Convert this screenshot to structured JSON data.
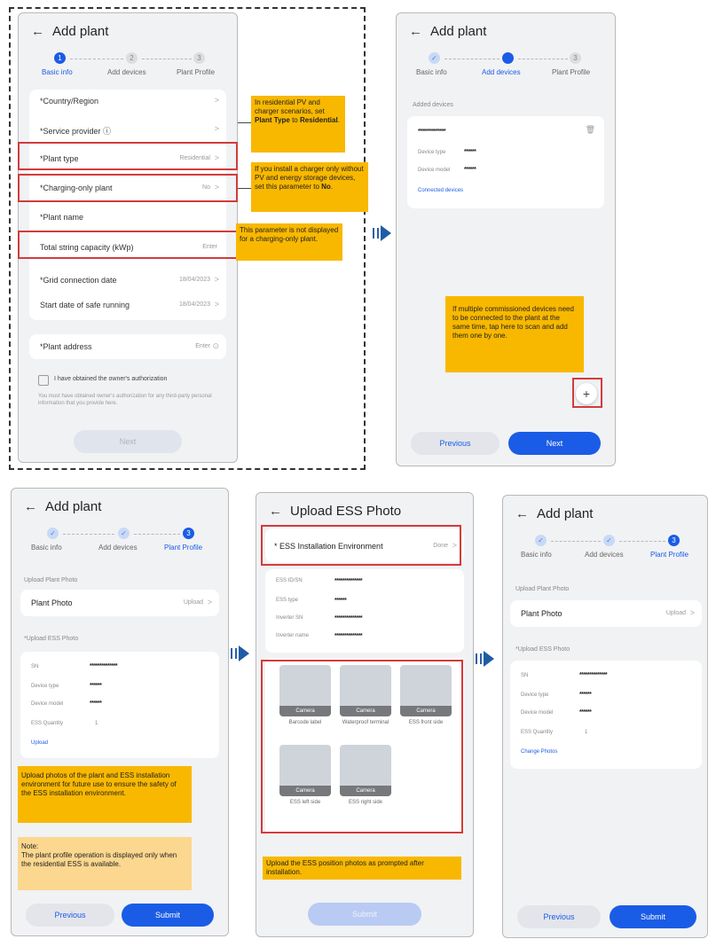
{
  "common": {
    "back_icon": "←",
    "add_plant_title": "Add plant",
    "step_basic": "Basic info",
    "step_devices": "Add devices",
    "step_profile": "Plant Profile",
    "check_glyph": "✓",
    "chevron": ">"
  },
  "screen1": {
    "step_nums": [
      "1",
      "2",
      "3"
    ],
    "rows": [
      {
        "label": "*Country/Region",
        "value": ""
      },
      {
        "label": "*Service provider ⓘ",
        "value": ""
      },
      {
        "label": "*Plant type",
        "value": "Residential"
      },
      {
        "label": "*Charging-only plant",
        "value": "No"
      },
      {
        "label": "*Plant name",
        "value": ""
      },
      {
        "label": "Total string capacity (kWp)",
        "value": "Enter"
      },
      {
        "label": "*Grid connection date",
        "value": "18/04/2023"
      },
      {
        "label": "Start date of safe running",
        "value": "18/04/2023"
      },
      {
        "label": "*Plant address",
        "value": "Enter"
      }
    ],
    "auth_label": "I have obtained the owner's authorization",
    "auth_note": "You must have obtained owner's authorization for any third-party personal information that you provide here.",
    "next_label": "Next",
    "location_icon": "⊙"
  },
  "notes_left": {
    "plant_type_pre": "In residential PV and charger scenarios, set ",
    "plant_type_bold1": "Plant Type",
    "plant_type_mid": " to ",
    "plant_type_bold2": "Residential",
    "plant_type_post": ".",
    "charging_pre": "If you install a charger only without PV and energy storage devices, set this parameter to ",
    "charging_bold": "No",
    "charging_post": ".",
    "capacity": "This parameter is not displayed for a charging-only plant."
  },
  "screen2": {
    "step_num_3": "3",
    "section": "Added devices",
    "masked_sn": "**************",
    "device_type_label": "Device type",
    "device_model_label": "Device model",
    "masked_short": "******",
    "connected_devices": "Connected devices",
    "note": "If multiple commissioned devices need to be connected to the plant at the same time, tap here to scan and add them one by one.",
    "fab": "+",
    "previous": "Previous",
    "next": "Next",
    "delete_icon": "🗑"
  },
  "screen3": {
    "step_num_3": "3",
    "upload_plant_photo": "Upload Plant Photo",
    "plant_photo": "Plant Photo",
    "upload": "Upload",
    "upload_ess_photo": "*Upload ESS Photo",
    "sn_label": "SN",
    "masked_sn": "**************",
    "device_type_label": "Device type",
    "device_model_label": "Device model",
    "masked_short": "******",
    "ess_quantity_label": "ESS Quantity",
    "ess_quantity": "1",
    "upload_link": "Upload",
    "note1": "Upload photos of the plant and ESS installation environment for future use to ensure the safety of the ESS installation environment.",
    "note2": "Note:\nThe plant profile operation is displayed only when the residential ESS is available.",
    "previous": "Previous",
    "submit": "Submit"
  },
  "screen4": {
    "title": "Upload ESS Photo",
    "env_label": "* ESS Installation Environment",
    "env_value": "Done",
    "fields": [
      {
        "label": "ESS ID/SN",
        "value": "**************"
      },
      {
        "label": "ESS type",
        "value": "******"
      },
      {
        "label": "Inverter SN",
        "value": "**************"
      },
      {
        "label": "Inverter name",
        "value": "**************"
      }
    ],
    "camera": "Camera",
    "photos": [
      "Barcode label",
      "Waterproof terminal",
      "ESS front side",
      "ESS left side",
      "ESS right side"
    ],
    "note": "Upload the ESS position photos as prompted after installation.",
    "submit": "Submit"
  },
  "screen5": {
    "step_num_3": "3",
    "upload_plant_photo": "Upload Plant Photo",
    "plant_photo": "Plant Photo",
    "upload": "Upload",
    "upload_ess_photo": "*Upload ESS Photo",
    "sn_label": "SN",
    "masked_sn": "**************",
    "device_type_label": "Device type",
    "device_model_label": "Device model",
    "masked_short": "******",
    "ess_quantity_label": "ESS Quantity",
    "ess_quantity": "1",
    "change_photos": "Change Photos",
    "previous": "Previous",
    "submit": "Submit"
  },
  "colors": {
    "accent": "#1a5ce6",
    "note": "#f8b800",
    "note_light": "#fbd78f",
    "highlight": "#d33b3b",
    "arrow": "#1f5ca4"
  }
}
